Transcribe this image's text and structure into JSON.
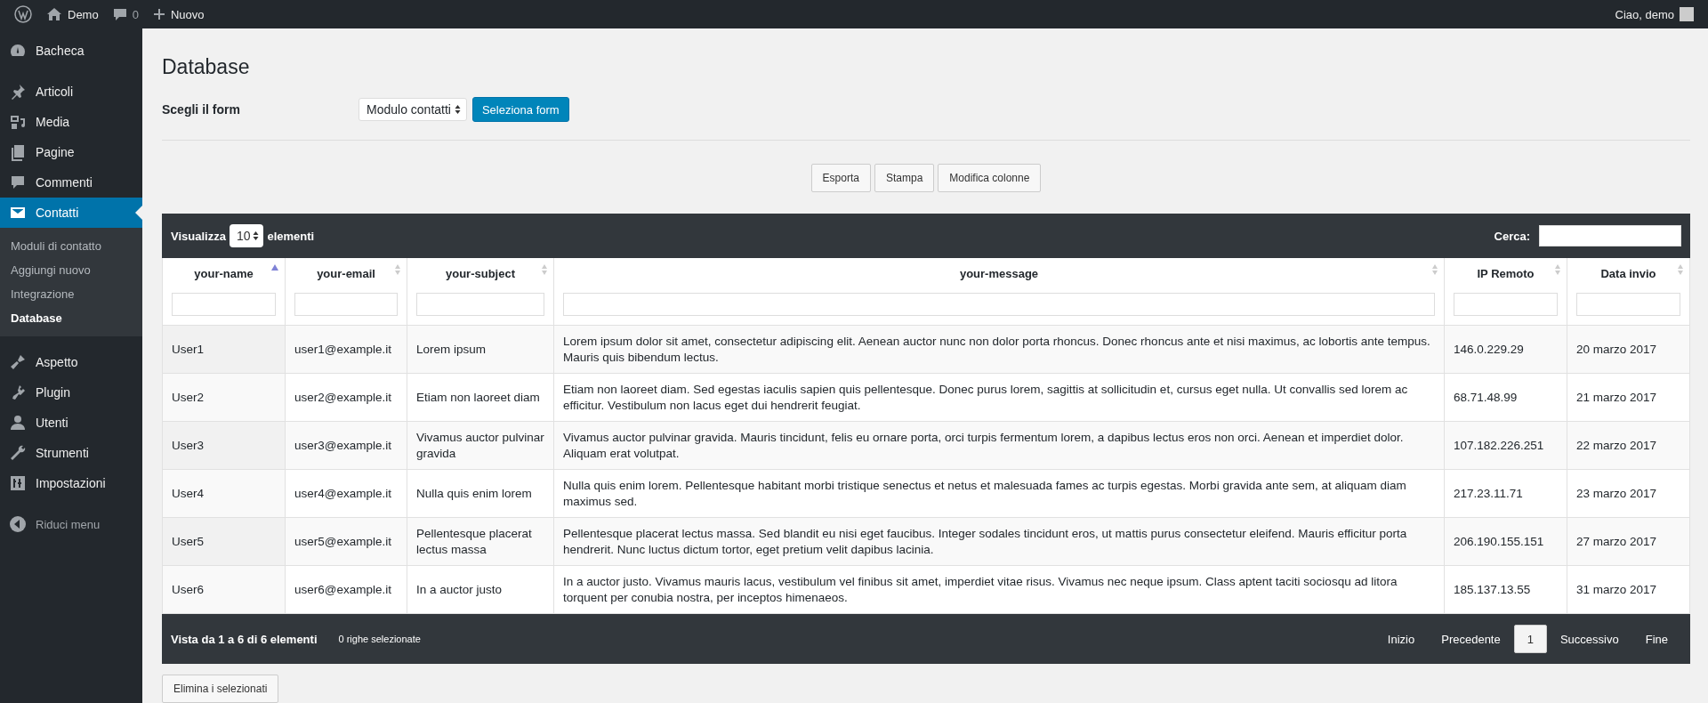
{
  "admin_bar": {
    "site": "Demo",
    "comments": "0",
    "new": "Nuovo",
    "greeting": "Ciao, demo"
  },
  "sidebar": {
    "sections": [
      {
        "items": [
          {
            "label": "Bacheca",
            "selected": false
          }
        ]
      },
      {
        "items": [
          {
            "label": "Articoli",
            "selected": false
          },
          {
            "label": "Media",
            "selected": false
          },
          {
            "label": "Pagine",
            "selected": false
          },
          {
            "label": "Commenti",
            "selected": false
          },
          {
            "label": "Contatti",
            "selected": true,
            "children": [
              {
                "label": "Moduli di contatto",
                "selected": false
              },
              {
                "label": "Aggiungi nuovo",
                "selected": false
              },
              {
                "label": "Integrazione",
                "selected": false
              },
              {
                "label": "Database",
                "selected": true
              }
            ]
          }
        ]
      },
      {
        "items": [
          {
            "label": "Aspetto",
            "selected": false
          },
          {
            "label": "Plugin",
            "selected": false
          },
          {
            "label": "Utenti",
            "selected": false
          },
          {
            "label": "Strumenti",
            "selected": false
          },
          {
            "label": "Impostazioni",
            "selected": false
          }
        ]
      }
    ],
    "collapse": "Riduci menu"
  },
  "page_title": "Database",
  "form_picker": {
    "label": "Scegli il form",
    "value": "Modulo contatti",
    "button": "Seleziona form"
  },
  "actions": [
    "Esporta",
    "Stampa",
    "Modifica colonne"
  ],
  "table": {
    "length_before": "Visualizza",
    "length_value": "10",
    "length_after": "elementi",
    "search_label": "Cerca:",
    "columns": [
      {
        "label": "your-name",
        "sorted": true
      },
      {
        "label": "your-email",
        "sorted": false
      },
      {
        "label": "your-subject",
        "sorted": false
      },
      {
        "label": "your-message",
        "sorted": false
      },
      {
        "label": "IP Remoto",
        "sorted": false
      },
      {
        "label": "Data invio",
        "sorted": false
      }
    ],
    "rows": [
      [
        "User1",
        "user1@example.it",
        "Lorem ipsum",
        "Lorem ipsum dolor sit amet, consectetur adipiscing elit. Aenean auctor nunc non dolor porta rhoncus. Donec rhoncus ante et nisi maximus, ac lobortis ante tempus. Mauris quis bibendum lectus.",
        "146.0.229.29",
        "20 marzo 2017"
      ],
      [
        "User2",
        "user2@example.it",
        "Etiam non laoreet diam",
        "Etiam non laoreet diam. Sed egestas iaculis sapien quis pellentesque. Donec purus lorem, sagittis at sollicitudin et, cursus eget nulla. Ut convallis sed lorem ac efficitur. Vestibulum non lacus eget dui hendrerit feugiat.",
        "68.71.48.99",
        "21 marzo 2017"
      ],
      [
        "User3",
        "user3@example.it",
        "Vivamus auctor pulvinar gravida",
        "Vivamus auctor pulvinar gravida. Mauris tincidunt, felis eu ornare porta, orci turpis fermentum lorem, a dapibus lectus eros non orci. Aenean et imperdiet dolor. Aliquam erat volutpat.",
        "107.182.226.251",
        "22 marzo 2017"
      ],
      [
        "User4",
        "user4@example.it",
        "Nulla quis enim lorem",
        "Nulla quis enim lorem. Pellentesque habitant morbi tristique senectus et netus et malesuada fames ac turpis egestas. Morbi gravida ante sem, at aliquam diam maximus sed.",
        "217.23.11.71",
        "23 marzo 2017"
      ],
      [
        "User5",
        "user5@example.it",
        "Pellentesque placerat lectus massa",
        "Pellentesque placerat lectus massa. Sed blandit eu nisi eget faucibus. Integer sodales tincidunt eros, ut mattis purus consectetur eleifend. Mauris efficitur porta hendrerit. Nunc luctus dictum tortor, eget pretium velit dapibus lacinia.",
        "206.190.155.151",
        "27 marzo 2017"
      ],
      [
        "User6",
        "user6@example.it",
        "In a auctor justo",
        "In a auctor justo. Vivamus mauris lacus, vestibulum vel finibus sit amet, imperdiet vitae risus. Vivamus nec neque ipsum. Class aptent taciti sociosqu ad litora torquent per conubia nostra, per inceptos himenaeos.",
        "185.137.13.55",
        "31 marzo 2017"
      ]
    ],
    "info": "Vista da 1 a 6 di 6 elementi",
    "selected_info": "0 righe selezionate",
    "pagination": [
      {
        "label": "Inizio",
        "selected": false
      },
      {
        "label": "Precedente",
        "selected": false
      },
      {
        "label": "1",
        "selected": true
      },
      {
        "label": "Successivo",
        "selected": false
      },
      {
        "label": "Fine",
        "selected": false
      }
    ]
  },
  "delete_button": "Elimina i selezionati"
}
